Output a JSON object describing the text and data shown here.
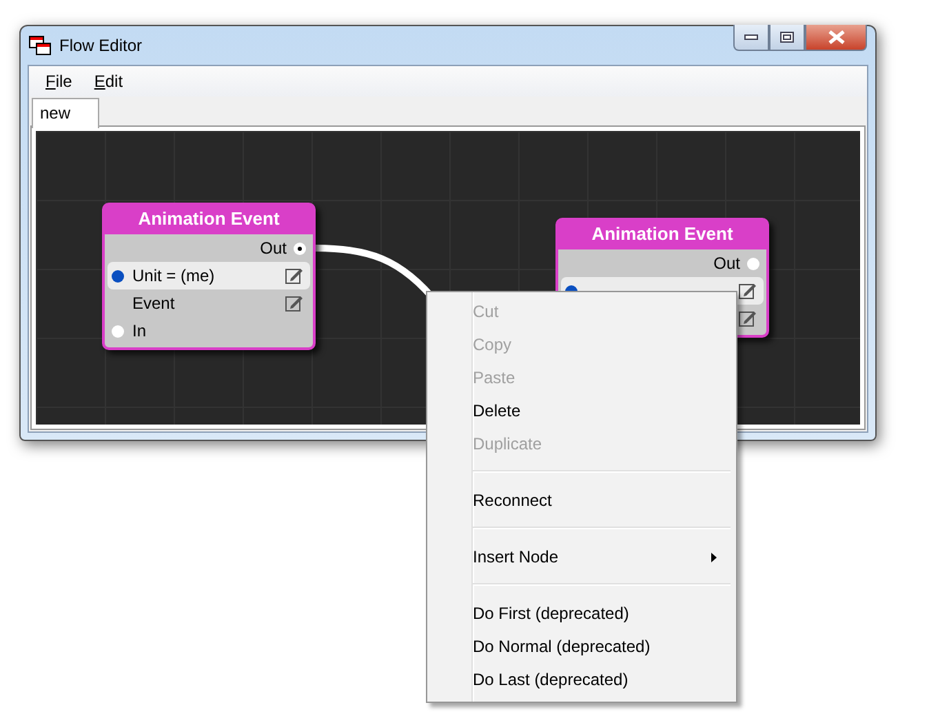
{
  "window": {
    "title": "Flow Editor"
  },
  "menu_bar": [
    {
      "label": "File"
    },
    {
      "label": "Edit"
    }
  ],
  "tabs": [
    {
      "label": "new",
      "selected": true
    }
  ],
  "nodes": [
    {
      "title": "Animation Event",
      "rows": [
        {
          "kind": "out",
          "label": "Out",
          "connected": true
        },
        {
          "kind": "param",
          "label": "Unit = (me)",
          "pin": true,
          "editable": true,
          "highlighted": true
        },
        {
          "kind": "param",
          "label": "Event",
          "pin": false,
          "editable": true,
          "highlighted": false
        },
        {
          "kind": "in",
          "label": "In"
        }
      ]
    },
    {
      "title": "Animation Event",
      "rows": [
        {
          "kind": "out",
          "label": "Out",
          "connected": false
        },
        {
          "kind": "param",
          "pin": true,
          "editable": true,
          "highlighted": true
        },
        {
          "kind": "param",
          "pin": false,
          "editable": true,
          "highlighted": false
        }
      ]
    }
  ],
  "context_menu": [
    {
      "kind": "item",
      "label": "Cut",
      "disabled": true
    },
    {
      "kind": "item",
      "label": "Copy",
      "disabled": true
    },
    {
      "kind": "item",
      "label": "Paste",
      "disabled": true
    },
    {
      "kind": "item",
      "label": "Delete",
      "disabled": false
    },
    {
      "kind": "item",
      "label": "Duplicate",
      "disabled": true
    },
    {
      "kind": "separator"
    },
    {
      "kind": "item",
      "label": "Reconnect",
      "disabled": false
    },
    {
      "kind": "separator"
    },
    {
      "kind": "submenu",
      "label": "Insert Node",
      "disabled": false
    },
    {
      "kind": "separator"
    },
    {
      "kind": "item",
      "label": "Do First (deprecated)",
      "disabled": false
    },
    {
      "kind": "item",
      "label": "Do Normal (deprecated)",
      "disabled": false
    },
    {
      "kind": "item",
      "label": "Do Last (deprecated)",
      "disabled": false
    }
  ]
}
